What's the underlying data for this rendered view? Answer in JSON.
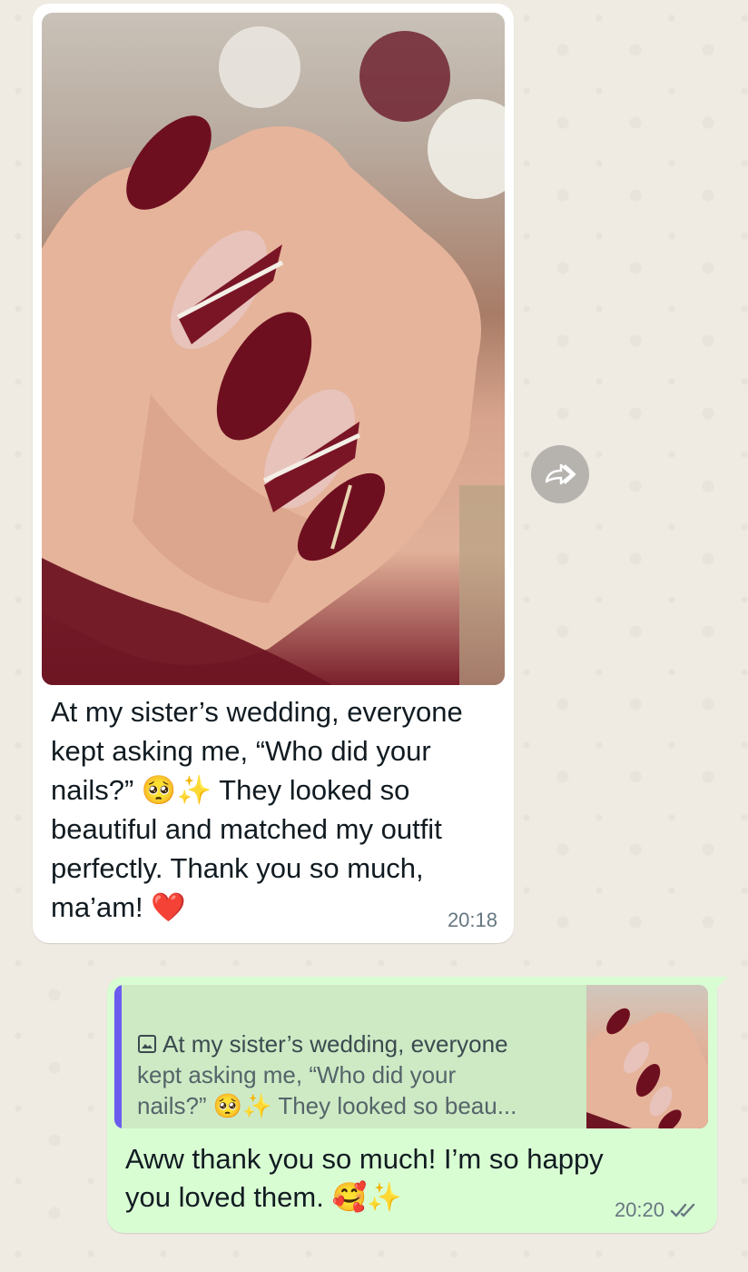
{
  "incoming_message": {
    "text": "At my sister’s wedding, everyone kept asking me, “Who did your nails?” 🥺✨ They looked so beautiful and matched my outfit perfectly. Thank you so much, ma’am! ❤️",
    "time": "20:18",
    "photo_icon": "photo-nails"
  },
  "forward_button": {
    "icon": "forward-icon"
  },
  "outgoing_message": {
    "quote": {
      "icon": "image-icon",
      "line1": "At my sister’s wedding, everyone",
      "line2": "kept asking me, “Who did your",
      "line3": "nails?” 🥺✨  They looked so beau..."
    },
    "text": "Aww thank you so much! I’m so happy you loved them. 🥰✨",
    "time": "20:20",
    "status_icon": "double-check-icon"
  },
  "colors": {
    "chat_background": "#efeae2",
    "incoming_bubble": "#ffffff",
    "outgoing_bubble": "#d9fdd3",
    "quote_bar": "#6b5cf0",
    "nail_burgundy": "#6e0f1f"
  }
}
